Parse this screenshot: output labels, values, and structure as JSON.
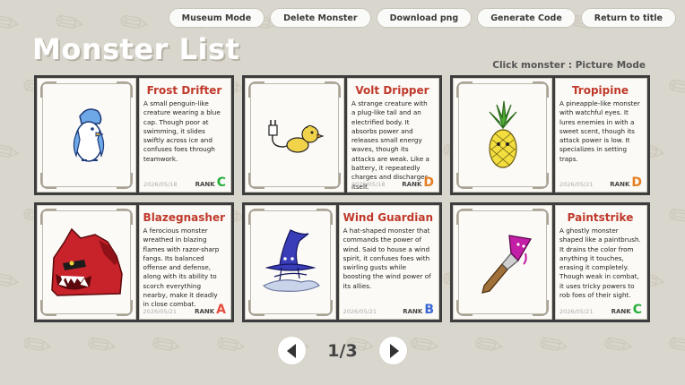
{
  "header": {
    "title": "Monster List",
    "hint": "Click monster : Picture Mode"
  },
  "nav": {
    "museum": "Museum Mode",
    "delete": "Delete Monster",
    "download": "Download png",
    "generate": "Generate Code",
    "return": "Return to title"
  },
  "rank_label": "RANK",
  "monsters": [
    {
      "name": "Frost Drifter",
      "description": "A small penguin-like creature wearing a blue cap. Though poor at swimming, it slides swiftly across ice and confuses foes through teamwork.",
      "date": "2026/05/18",
      "rank": "C",
      "rank_color": "#27ae3a",
      "icon": "penguin-icon"
    },
    {
      "name": "Volt Dripper",
      "description": "A strange creature with a plug-like tail and an electrified body. It absorbs power and releases small energy waves, though its attacks are weak. Like a battery, it repeatedly charges and discharges itself.",
      "date": "2026/05/18",
      "rank": "D",
      "rank_color": "#e67e22",
      "icon": "plug-bird-icon"
    },
    {
      "name": "Tropipine",
      "description": "A pineapple-like monster with watchful eyes. It lures enemies in with a sweet scent, though its attack power is low. It specializes in setting traps.",
      "date": "2026/05/21",
      "rank": "D",
      "rank_color": "#e67e22",
      "icon": "pineapple-icon"
    },
    {
      "name": "Blazegnasher",
      "description": "A ferocious monster wreathed in blazing flames with razor-sharp fangs. Its balanced offense and defense, along with its ability to scorch everything nearby, make it deadly in close combat.",
      "date": "2026/05/21",
      "rank": "A",
      "rank_color": "#e74c3c",
      "icon": "red-beast-icon"
    },
    {
      "name": "Wind Guardian",
      "description": "A hat-shaped monster that commands the power of wind. Said to house a wind spirit, it confuses foes with swirling gusts while boosting the wind power of its allies.",
      "date": "2026/05/21",
      "rank": "B",
      "rank_color": "#3a66d6",
      "icon": "wizard-hat-icon"
    },
    {
      "name": "Paintstrike",
      "description": "A ghostly monster shaped like a paintbrush. It drains the color from anything it touches, erasing it completely. Though weak in combat, it uses tricky powers to rob foes of their sight.",
      "date": "2026/05/21",
      "rank": "C",
      "rank_color": "#27ae3a",
      "icon": "paintbrush-icon"
    }
  ],
  "pager": {
    "label": "1/3",
    "prev_icon": "arrow-left-icon",
    "next_icon": "arrow-right-icon"
  },
  "colors": {
    "background": "#d9d6cd",
    "name_red": "#c0392b",
    "card_border": "#3d3d3d"
  }
}
